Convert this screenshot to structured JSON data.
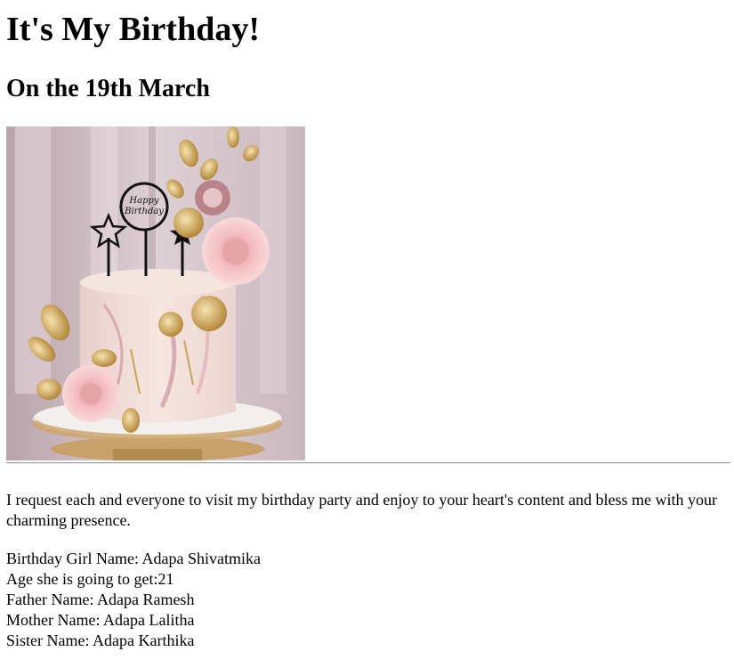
{
  "page": {
    "title": "It's My Birthday!",
    "subtitle": "On the 19th March",
    "image": {
      "description_icon": "birthday-cake-image",
      "topper_text": "Happy Birthday"
    },
    "invitation": "I request each and everyone to visit my birthday party and enjoy to your heart's content and bless me with your charming presence.",
    "details": [
      "Birthday Girl Name: Adapa Shivatmika",
      "Age she is going to get:21",
      "Father Name: Adapa Ramesh",
      "Mother Name: Adapa Lalitha",
      "Sister Name: Adapa Karthika"
    ]
  },
  "colors": {
    "background_wall": "#d9c9cf",
    "cake_body": "#f1dcd8",
    "rose_pink": "#f2b9bd",
    "gold": "#c9a45c",
    "divider": "#9a9a9a"
  }
}
